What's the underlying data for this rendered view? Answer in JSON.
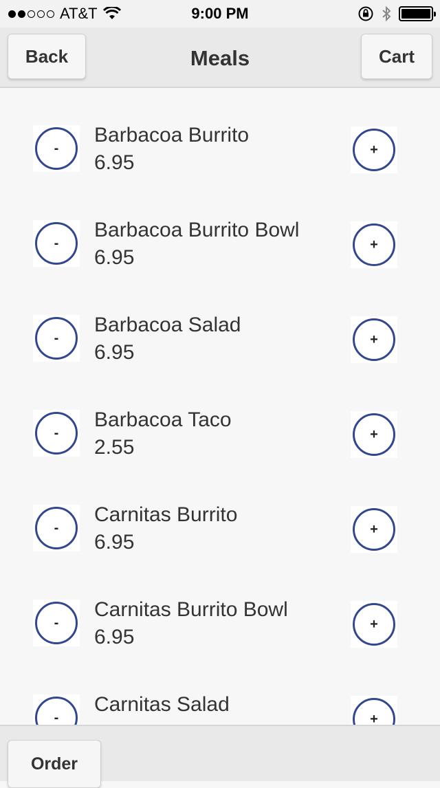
{
  "status_bar": {
    "carrier": "AT&T",
    "signal_bars_filled": 2,
    "signal_bars_total": 5,
    "time": "9:00 PM",
    "icons": [
      "wifi-icon",
      "orientation-lock-icon",
      "bluetooth-icon",
      "battery-icon"
    ]
  },
  "header": {
    "back_label": "Back",
    "title": "Meals",
    "cart_label": "Cart"
  },
  "items": [
    {
      "name": "Barbacoa Burrito",
      "price": "6.95",
      "minus": "-",
      "plus": "+"
    },
    {
      "name": "Barbacoa Burrito Bowl",
      "price": "6.95",
      "minus": "-",
      "plus": "+"
    },
    {
      "name": "Barbacoa Salad",
      "price": "6.95",
      "minus": "-",
      "plus": "+"
    },
    {
      "name": "Barbacoa Taco",
      "price": "2.55",
      "minus": "-",
      "plus": "+"
    },
    {
      "name": "Carnitas Burrito",
      "price": "6.95",
      "minus": "-",
      "plus": "+"
    },
    {
      "name": "Carnitas Burrito Bowl",
      "price": "6.95",
      "minus": "-",
      "plus": "+"
    },
    {
      "name": "Carnitas Salad",
      "price": "",
      "minus": "-",
      "plus": "+"
    }
  ],
  "footer": {
    "order_label": "Order"
  },
  "colors": {
    "accent": "#33478f",
    "bar_background": "#e9e9e9",
    "page_background": "#f7f7f7"
  }
}
